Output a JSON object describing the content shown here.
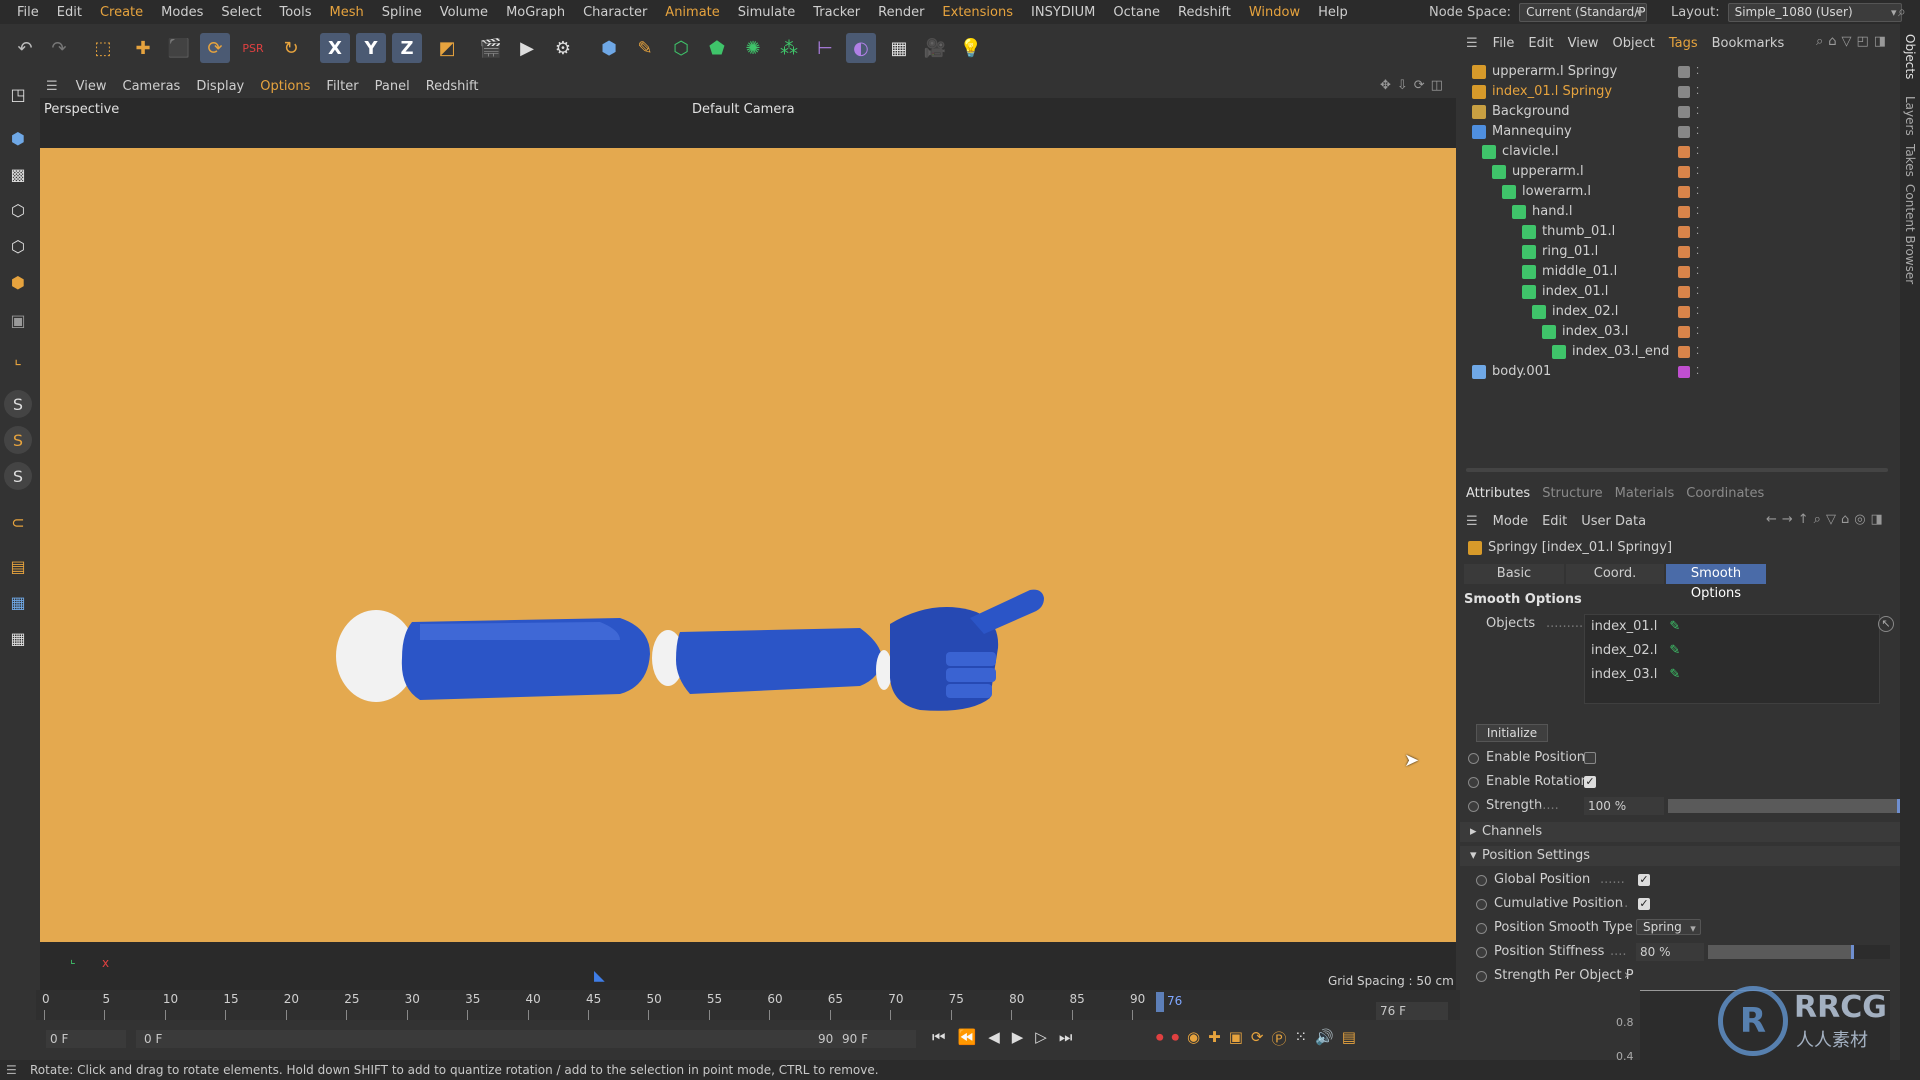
{
  "menubar": {
    "items": [
      "File",
      "Edit",
      "Create",
      "Modes",
      "Select",
      "Tools",
      "Mesh",
      "Spline",
      "Volume",
      "MoGraph",
      "Character",
      "Animate",
      "Simulate",
      "Tracker",
      "Render",
      "Extensions",
      "INSYDIUM",
      "Octane",
      "Redshift",
      "Window",
      "Help"
    ],
    "accent_items": [
      "Create",
      "Mesh",
      "Animate",
      "Extensions",
      "Window"
    ],
    "node_space_label": "Node Space:",
    "node_space_value": "Current (Standard/P",
    "layout_label": "Layout:",
    "layout_value": "Simple_1080 (User)"
  },
  "toolbar": {
    "axis_labels": [
      "X",
      "Y",
      "Z"
    ]
  },
  "viewport": {
    "menu": [
      "View",
      "Cameras",
      "Display",
      "Options",
      "Filter",
      "Panel",
      "Redshift"
    ],
    "accent_menu": [
      "Options"
    ],
    "view_name": "Perspective",
    "camera_name": "Default Camera",
    "grid_spacing": "Grid Spacing : 50 cm",
    "axis_x": "x",
    "bg_color": "#e4a94f",
    "model_color": "#2b55c7"
  },
  "timeline": {
    "ticks": [
      "0",
      "5",
      "10",
      "15",
      "20",
      "25",
      "30",
      "35",
      "40",
      "45",
      "50",
      "55",
      "60",
      "65",
      "70",
      "75",
      "80",
      "85",
      "90"
    ],
    "current_frame": "76",
    "frame_field": "76 F",
    "start_field": "0 F",
    "range_start": "0 F",
    "range_end": "90 F",
    "end_field": "90 F"
  },
  "status_text": "Rotate: Click and drag to rotate elements. Hold down SHIFT to add to quantize rotation / add to the selection in point mode, CTRL to remove.",
  "object_manager": {
    "menu": [
      "File",
      "Edit",
      "View",
      "Object",
      "Tags",
      "Bookmarks"
    ],
    "accent_menu": [
      "Tags"
    ],
    "objects": [
      {
        "name": "upperarm.l Springy",
        "accent": false
      },
      {
        "name": "index_01.l Springy",
        "accent": true
      },
      {
        "name": "Background",
        "accent": false
      },
      {
        "name": "Mannequiny",
        "accent": false
      },
      {
        "name": "clavicle.l",
        "accent": false
      },
      {
        "name": "upperarm.l",
        "accent": false
      },
      {
        "name": "lowerarm.l",
        "accent": false
      },
      {
        "name": "hand.l",
        "accent": false
      },
      {
        "name": "thumb_01.l",
        "accent": false
      },
      {
        "name": "ring_01.l",
        "accent": false
      },
      {
        "name": "middle_01.l",
        "accent": false
      },
      {
        "name": "index_01.l",
        "accent": false
      },
      {
        "name": "index_02.l",
        "accent": false
      },
      {
        "name": "index_03.l",
        "accent": false
      },
      {
        "name": "index_03.l_end",
        "accent": false
      },
      {
        "name": "body.001",
        "accent": false
      }
    ]
  },
  "attributes": {
    "tabs": [
      "Attributes",
      "Structure",
      "Materials",
      "Coordinates"
    ],
    "menu": [
      "Mode",
      "Edit",
      "User Data"
    ],
    "object_title": "Springy [index_01.l Springy]",
    "subtabs": [
      "Basic",
      "Coord.",
      "Smooth Options"
    ],
    "active_subtab": "Smooth Options",
    "section_title": "Smooth Options",
    "objects_label": "Objects",
    "objects_list": [
      "index_01.l",
      "index_02.l",
      "index_03.l"
    ],
    "initialize_button": "Initialize",
    "enable_position_label": "Enable Position",
    "enable_position": false,
    "enable_rotation_label": "Enable Rotation",
    "enable_rotation": true,
    "strength_label": "Strength",
    "strength_value": "100 %",
    "strength_fraction": 1.0,
    "channels_label": "Channels",
    "position_settings_label": "Position Settings",
    "global_position_label": "Global Position",
    "global_position": true,
    "cumulative_position_label": "Cumulative Position",
    "cumulative_position": true,
    "smooth_type_label": "Position Smooth Type",
    "smooth_type_value": "Spring",
    "stiffness_label": "Position Stiffness",
    "stiffness_value": "80 %",
    "stiffness_fraction": 0.8,
    "strength_per_object_label": "Strength Per Object P",
    "graph_labels": [
      "0.8",
      "0.4"
    ]
  },
  "right_tabs": [
    "Objects",
    "Layers",
    "Takes",
    "Content Browser"
  ],
  "watermark": {
    "brand": "RRCG",
    "sub": "人人素材"
  }
}
